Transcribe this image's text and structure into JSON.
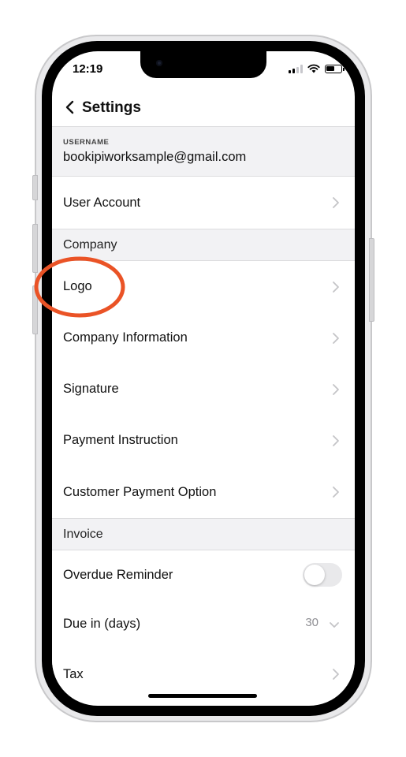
{
  "status": {
    "time": "12:19"
  },
  "nav": {
    "title": "Settings",
    "back_icon": "chevron-left-icon"
  },
  "username": {
    "label": "USERNAME",
    "value": "bookipiworksample@gmail.com"
  },
  "rows": {
    "user_account": "User Account",
    "section_company": "Company",
    "logo": "Logo",
    "company_information": "Company Information",
    "signature": "Signature",
    "payment_instruction": "Payment Instruction",
    "customer_payment_option": "Customer Payment Option",
    "section_invoice": "Invoice",
    "overdue_reminder": "Overdue Reminder",
    "due_in_days": "Due in (days)",
    "due_in_days_value": "30",
    "tax": "Tax"
  },
  "toggles": {
    "overdue_reminder_on": false
  },
  "colors": {
    "annotation": "#ea5326",
    "section_bg": "#f2f2f4",
    "chevron": "#c4c4c7"
  }
}
